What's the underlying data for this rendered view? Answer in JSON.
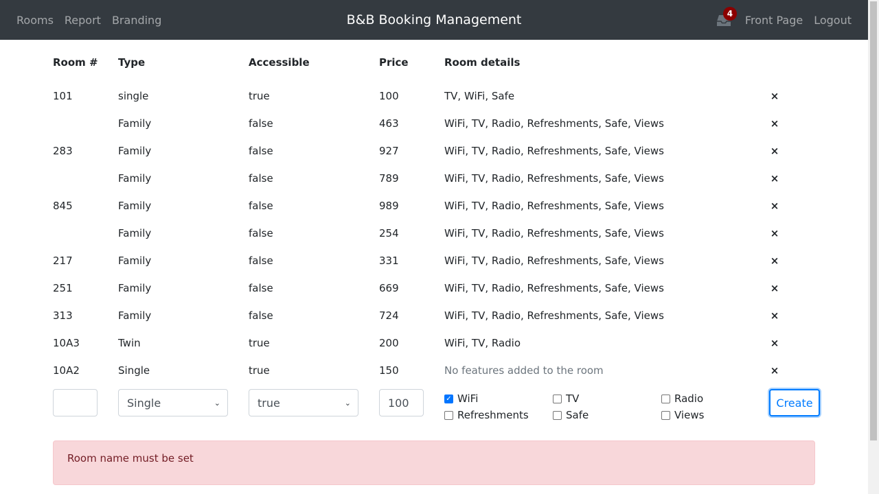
{
  "nav": {
    "links_left": [
      "Rooms",
      "Report",
      "Branding"
    ],
    "brand": "B&B Booking Management",
    "notification_count": "4",
    "links_right": [
      "Front Page",
      "Logout"
    ]
  },
  "table": {
    "headers": [
      "Room #",
      "Type",
      "Accessible",
      "Price",
      "Room details"
    ],
    "rows": [
      {
        "number": "101",
        "type": "single",
        "accessible": "true",
        "price": "100",
        "details": "TV, WiFi, Safe"
      },
      {
        "number": "",
        "type": "Family",
        "accessible": "false",
        "price": "463",
        "details": "WiFi, TV, Radio, Refreshments, Safe, Views"
      },
      {
        "number": "283",
        "type": "Family",
        "accessible": "false",
        "price": "927",
        "details": "WiFi, TV, Radio, Refreshments, Safe, Views"
      },
      {
        "number": "",
        "type": "Family",
        "accessible": "false",
        "price": "789",
        "details": "WiFi, TV, Radio, Refreshments, Safe, Views"
      },
      {
        "number": "845",
        "type": "Family",
        "accessible": "false",
        "price": "989",
        "details": "WiFi, TV, Radio, Refreshments, Safe, Views"
      },
      {
        "number": "",
        "type": "Family",
        "accessible": "false",
        "price": "254",
        "details": "WiFi, TV, Radio, Refreshments, Safe, Views"
      },
      {
        "number": "217",
        "type": "Family",
        "accessible": "false",
        "price": "331",
        "details": "WiFi, TV, Radio, Refreshments, Safe, Views"
      },
      {
        "number": "251",
        "type": "Family",
        "accessible": "false",
        "price": "669",
        "details": "WiFi, TV, Radio, Refreshments, Safe, Views"
      },
      {
        "number": "313",
        "type": "Family",
        "accessible": "false",
        "price": "724",
        "details": "WiFi, TV, Radio, Refreshments, Safe, Views"
      },
      {
        "number": "10A3",
        "type": "Twin",
        "accessible": "true",
        "price": "200",
        "details": "WiFi, TV, Radio"
      },
      {
        "number": "10A2",
        "type": "Single",
        "accessible": "true",
        "price": "150",
        "details": "No features added to the room",
        "muted": true
      }
    ],
    "delete_icon": "×"
  },
  "form": {
    "room_name_value": "",
    "type_selected": "Single",
    "accessible_selected": "true",
    "price_value": "100",
    "features": [
      {
        "label": "WiFi",
        "checked": true
      },
      {
        "label": "TV",
        "checked": false
      },
      {
        "label": "Radio",
        "checked": false
      },
      {
        "label": "Refreshments",
        "checked": false
      },
      {
        "label": "Safe",
        "checked": false
      },
      {
        "label": "Views",
        "checked": false
      }
    ],
    "create_label": "Create"
  },
  "alert": {
    "message": "Room name must be set"
  }
}
